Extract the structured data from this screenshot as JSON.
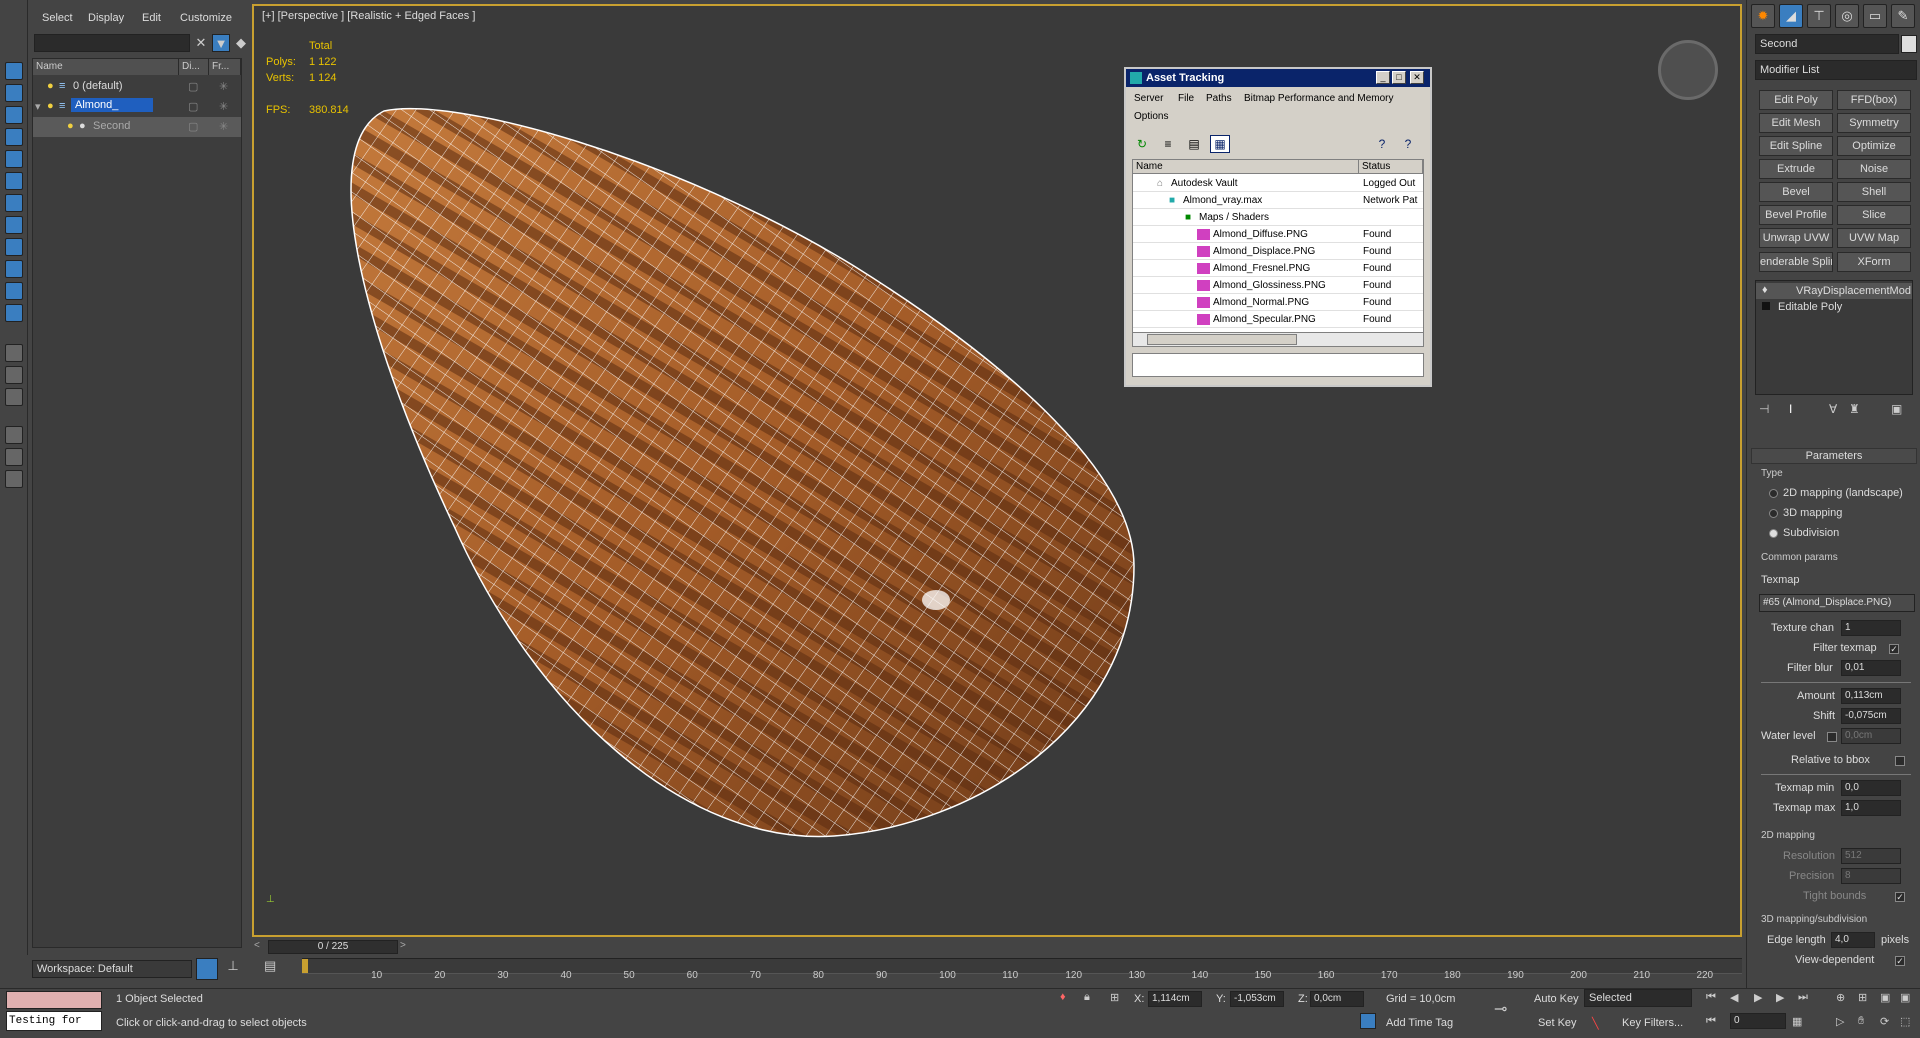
{
  "menu": {
    "items": [
      "Select",
      "Display",
      "Edit",
      "Customize"
    ]
  },
  "scene_explorer": {
    "columns": [
      "Name",
      "Di...",
      "Fr..."
    ],
    "rows": [
      {
        "name": "0 (default)"
      },
      {
        "name": "Almond_"
      },
      {
        "name": "Second"
      }
    ]
  },
  "workspace": {
    "label": "Workspace: Default"
  },
  "viewport": {
    "label": "[+] [Perspective ] [Realistic + Edged Faces ]",
    "stats": {
      "total_label": "Total",
      "polys_label": "Polys:",
      "polys": "1 122",
      "verts_label": "Verts:",
      "verts": "1 124",
      "fps_label": "FPS:",
      "fps": "380.814"
    }
  },
  "asset_tracking": {
    "title": "Asset Tracking",
    "menu": [
      "Server",
      "File",
      "Paths",
      "Bitmap Performance and Memory",
      "Options"
    ],
    "columns": [
      "Name",
      "Status"
    ],
    "rows": [
      {
        "name": "Autodesk Vault",
        "status": "Logged Out"
      },
      {
        "name": "Almond_vray.max",
        "status": "Network Pat"
      },
      {
        "name": "Maps / Shaders",
        "status": ""
      },
      {
        "name": "Almond_Diffuse.PNG",
        "status": "Found"
      },
      {
        "name": "Almond_Displace.PNG",
        "status": "Found"
      },
      {
        "name": "Almond_Fresnel.PNG",
        "status": "Found"
      },
      {
        "name": "Almond_Glossiness.PNG",
        "status": "Found"
      },
      {
        "name": "Almond_Normal.PNG",
        "status": "Found"
      },
      {
        "name": "Almond_Specular.PNG",
        "status": "Found"
      }
    ]
  },
  "modify_panel": {
    "object_name": "Second",
    "modifier_list": "Modifier List",
    "buttons": [
      "Edit Poly",
      "FFD(box)",
      "Edit Mesh",
      "Symmetry",
      "Edit Spline",
      "Optimize",
      "Extrude",
      "Noise",
      "Bevel",
      "Shell",
      "Bevel Profile",
      "Slice",
      "Unwrap UVW",
      "UVW Map",
      "enderable Splir",
      "XForm"
    ],
    "stack": [
      "VRayDisplacementMod",
      "Editable Poly"
    ],
    "parameters": {
      "title": "Parameters",
      "type_label": "Type",
      "type_options": [
        "2D mapping (landscape)",
        "3D mapping",
        "Subdivision"
      ],
      "common_label": "Common params",
      "texmap_label": "Texmap",
      "texmap_value": "#65 (Almond_Displace.PNG)",
      "texture_chan_label": "Texture chan",
      "texture_chan": "1",
      "filter_texmap_label": "Filter texmap",
      "filter_blur_label": "Filter blur",
      "filter_blur": "0,01",
      "amount_label": "Amount",
      "amount": "0,113cm",
      "shift_label": "Shift",
      "shift": "-0,075cm",
      "water_label": "Water level",
      "water": "0,0cm",
      "relative_label": "Relative to bbox",
      "texmap_min_label": "Texmap min",
      "texmap_min": "0,0",
      "texmap_max_label": "Texmap max",
      "texmap_max": "1,0",
      "mapping2d_label": "2D mapping",
      "resolution_label": "Resolution",
      "resolution": "512",
      "precision_label": "Precision",
      "precision": "8",
      "tight_label": "Tight bounds",
      "mapping3d_label": "3D mapping/subdivision",
      "edge_label": "Edge length",
      "edge": "4,0",
      "pixels_label": "pixels",
      "view_dep_label": "View-dependent"
    }
  },
  "timeline": {
    "frame": "0 / 225",
    "ticks": [
      "10",
      "20",
      "30",
      "40",
      "50",
      "60",
      "70",
      "80",
      "90",
      "100",
      "110",
      "120",
      "130",
      "140",
      "150",
      "160",
      "170",
      "180",
      "190",
      "200",
      "210",
      "220"
    ]
  },
  "status": {
    "maxscript": "Testing for",
    "selected": "1 Object Selected",
    "prompt": "Click or click-and-drag to select objects",
    "x": "1,114cm",
    "y": "-1,053cm",
    "z": "0,0cm",
    "grid": "Grid = 10,0cm",
    "auto_key": "Auto Key",
    "selected_dd": "Selected",
    "set_key": "Set Key",
    "key_filters": "Key Filters...",
    "add_time_tag": "Add Time Tag",
    "frame_field": "0"
  }
}
